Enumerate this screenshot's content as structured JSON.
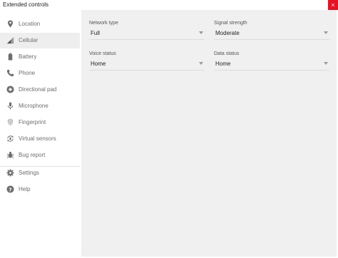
{
  "window": {
    "title": "Extended controls",
    "close_glyph": "×"
  },
  "sidebar": {
    "selected_index": 1,
    "items": [
      {
        "label": "Location",
        "icon": "location-pin-icon"
      },
      {
        "label": "Cellular",
        "icon": "cellular-signal-icon"
      },
      {
        "label": "Battery",
        "icon": "battery-icon"
      },
      {
        "label": "Phone",
        "icon": "phone-icon"
      },
      {
        "label": "Directional pad",
        "icon": "dpad-icon"
      },
      {
        "label": "Microphone",
        "icon": "microphone-icon"
      },
      {
        "label": "Fingerprint",
        "icon": "fingerprint-icon"
      },
      {
        "label": "Virtual sensors",
        "icon": "rotation-icon"
      },
      {
        "label": "Bug report",
        "icon": "bug-icon"
      },
      {
        "label": "Settings",
        "icon": "gear-icon"
      },
      {
        "label": "Help",
        "icon": "help-icon"
      }
    ]
  },
  "cellular": {
    "network_type": {
      "label": "Network type",
      "value": "Full"
    },
    "signal_strength": {
      "label": "Signal strength",
      "value": "Moderate"
    },
    "voice_status": {
      "label": "Voice status",
      "value": "Home"
    },
    "data_status": {
      "label": "Data status",
      "value": "Home"
    }
  },
  "colors": {
    "close_button": "#e81123",
    "selected_item_bg": "#eeeeee",
    "panel_bg": "#f0f0f0",
    "icon": "#6e6e6e"
  }
}
